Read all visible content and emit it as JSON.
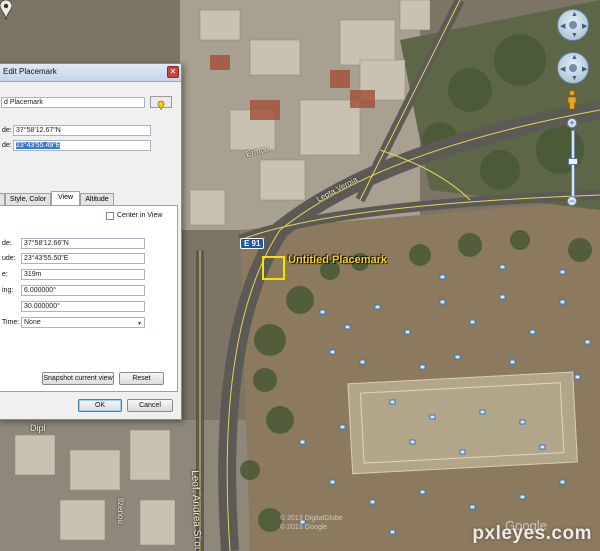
{
  "dialog": {
    "title": "Edit Placemark",
    "name_value": "d Placemark",
    "latitude_label": "de:",
    "latitude_value": "37°58'12.67\"N",
    "longitude_label": "de:",
    "longitude_value": "23°43'55.49\"E",
    "tabs": [
      {
        "label": ""
      },
      {
        "label": "Style, Color"
      },
      {
        "label": "View"
      },
      {
        "label": "Altitude"
      }
    ],
    "view_tab": {
      "center_in_view_label": "Center in View",
      "center_in_view_checked": false,
      "rows": [
        {
          "label": "de:",
          "value": "37°58'12.66\"N"
        },
        {
          "label": "ude:",
          "value": "23°43'55.50\"E"
        },
        {
          "label": "e:",
          "value": "319m"
        },
        {
          "label": "ing:",
          "value": "6.000000°"
        },
        {
          "label": "",
          "value": "30.000000°"
        }
      ],
      "time_label": "Time:",
      "time_value": "None",
      "snapshot_button": "Snapshot current view",
      "reset_button": "Reset"
    },
    "ok_button": "OK",
    "cancel_button": "Cancel"
  },
  "map": {
    "placemark_label": "Untitled Placemark",
    "route_shield": "E 91",
    "road_labels": [
      "Leof. Andrea Si ou",
      "Dipl",
      "Lepta Veroia",
      "Ermou",
      "Ilzenou"
    ],
    "copyright_lines": [
      "© 2013 DigitalGlobe",
      "© 2013 Google"
    ],
    "watermark": "pxleyes.com",
    "google_mark": "Google",
    "colors": {
      "placemark_highlight": "#f4e300",
      "placemark_label": "#f5d22b",
      "route_shield": "#1d57a8"
    }
  },
  "controls": {
    "look_icon": "look-around-icon",
    "move_icon": "move-pan-icon",
    "pegman_icon": "street-view-pegman-icon",
    "zoom_in": "+",
    "zoom_out": "−"
  }
}
